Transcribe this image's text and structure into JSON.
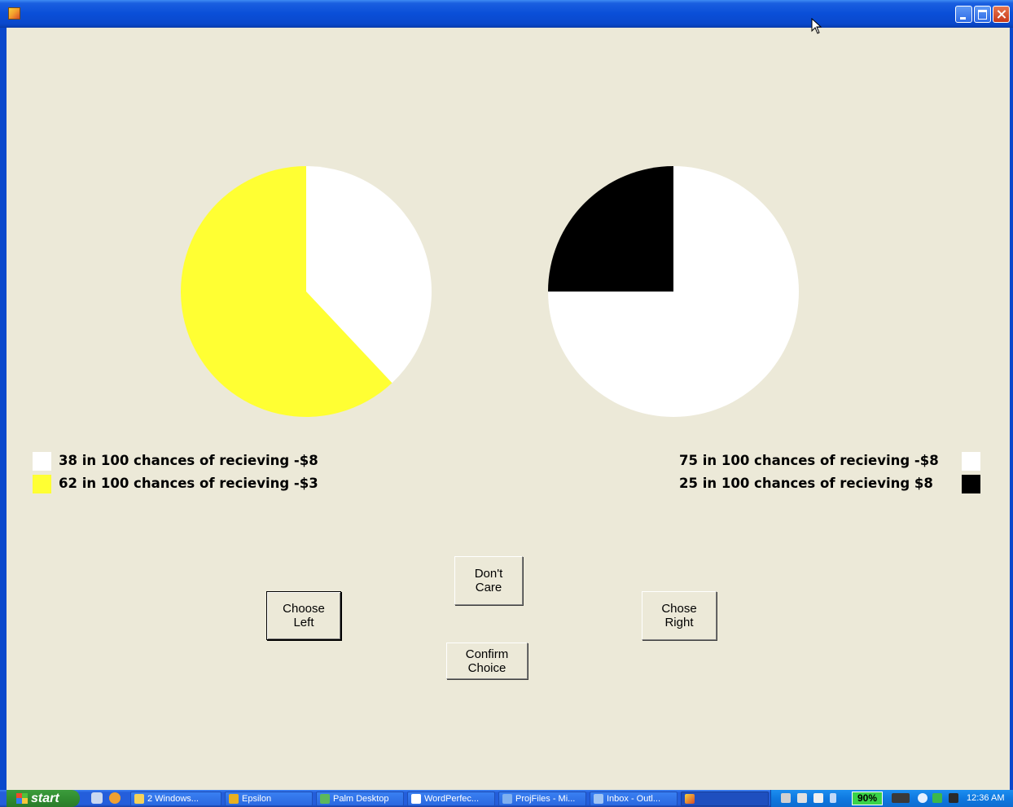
{
  "window": {
    "title": "",
    "controls": {
      "minimize_icon": "minimize-icon",
      "maximize_icon": "maximize-icon",
      "close_icon": "close-icon"
    }
  },
  "left_pie": {
    "slices": [
      {
        "label": "38 in 100 chances of recieving -$8",
        "value": 38,
        "color": "#ffffff"
      },
      {
        "label": "62 in 100 chances of recieving -$3",
        "value": 62,
        "color": "#ffff33"
      }
    ]
  },
  "right_pie": {
    "slices": [
      {
        "label": "75 in 100 chances of recieving -$8",
        "value": 75,
        "color": "#ffffff"
      },
      {
        "label": "25 in 100 chances of recieving $8",
        "value": 25,
        "color": "#000000"
      }
    ]
  },
  "buttons": {
    "choose_left": [
      "Choose",
      "Left"
    ],
    "dont_care": [
      "Don't",
      "Care"
    ],
    "chose_right": [
      "Chose",
      "Right"
    ],
    "confirm_choice": [
      "Confirm",
      "Choice"
    ]
  },
  "taskbar": {
    "start_label": "start",
    "items": [
      "2 Windows...",
      "Epsilon",
      "Palm Desktop",
      "WordPerfec...",
      "ProjFiles - Mi...",
      "Inbox - Outl...",
      ""
    ],
    "battery": "90%",
    "clock": "12:36 AM"
  }
}
